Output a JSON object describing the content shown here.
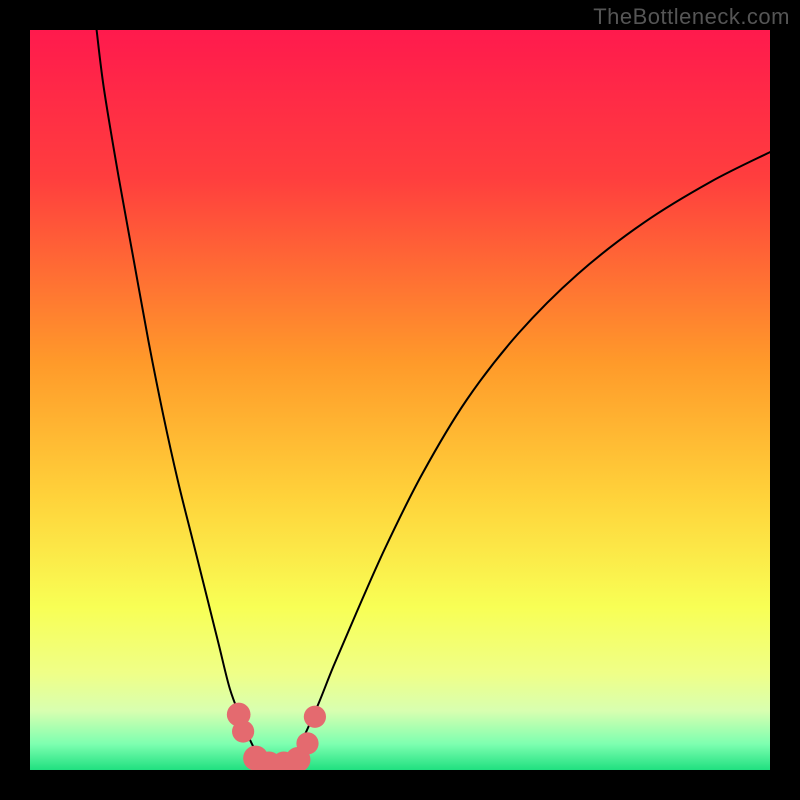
{
  "watermark": "TheBottleneck.com",
  "chart_data": {
    "type": "line",
    "title": "",
    "xlabel": "",
    "ylabel": "",
    "xlim": [
      0,
      100
    ],
    "ylim": [
      0,
      100
    ],
    "gradient_stops": [
      {
        "offset": 0.0,
        "color": "#ff1a4d"
      },
      {
        "offset": 0.2,
        "color": "#ff3e3e"
      },
      {
        "offset": 0.45,
        "color": "#ff9a2a"
      },
      {
        "offset": 0.63,
        "color": "#ffd23a"
      },
      {
        "offset": 0.78,
        "color": "#f8ff55"
      },
      {
        "offset": 0.87,
        "color": "#efff88"
      },
      {
        "offset": 0.92,
        "color": "#d8ffb0"
      },
      {
        "offset": 0.965,
        "color": "#7dffb0"
      },
      {
        "offset": 1.0,
        "color": "#20e080"
      }
    ],
    "series": [
      {
        "name": "curve-left",
        "x": [
          9,
          10,
          12,
          14,
          16,
          18,
          20,
          22,
          24,
          25.5,
          27,
          28.5,
          30,
          31,
          32,
          33
        ],
        "y": [
          100,
          92,
          80,
          69,
          58,
          48,
          39,
          31,
          23,
          17,
          11,
          7,
          3.5,
          1.8,
          1.0,
          0.8
        ]
      },
      {
        "name": "curve-right",
        "x": [
          33,
          34,
          35.5,
          37,
          39,
          41,
          44,
          48,
          53,
          59,
          66,
          74,
          83,
          92,
          100
        ],
        "y": [
          0.8,
          1.0,
          2.0,
          4.5,
          9,
          14,
          21,
          30,
          40,
          50,
          59,
          67,
          74,
          79.5,
          83.5
        ]
      }
    ],
    "markers": [
      {
        "x": 28.2,
        "y": 7.5,
        "r": 1.6
      },
      {
        "x": 28.8,
        "y": 5.2,
        "r": 1.5
      },
      {
        "x": 30.5,
        "y": 1.6,
        "r": 1.7
      },
      {
        "x": 32.3,
        "y": 0.8,
        "r": 1.7
      },
      {
        "x": 34.3,
        "y": 0.8,
        "r": 1.7
      },
      {
        "x": 36.2,
        "y": 1.4,
        "r": 1.7
      },
      {
        "x": 37.5,
        "y": 3.6,
        "r": 1.5
      },
      {
        "x": 38.5,
        "y": 7.2,
        "r": 1.5
      }
    ],
    "marker_color": "#e46a6f"
  }
}
